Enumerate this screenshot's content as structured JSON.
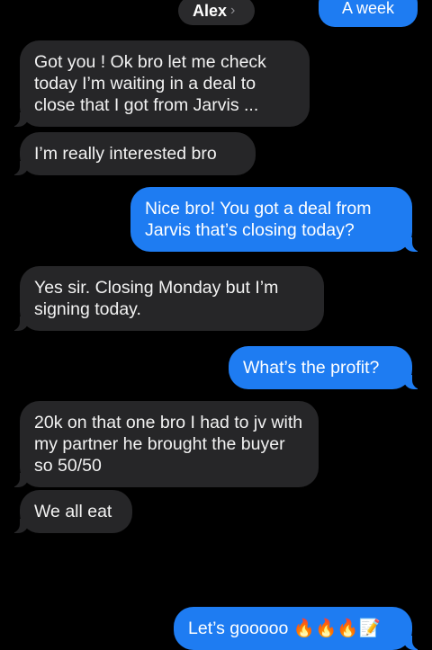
{
  "header": {
    "contact_name": "Alex",
    "chevron": "›",
    "partial_top_message": "A week"
  },
  "messages": [
    {
      "from": "them",
      "text": "Got you ! Ok bro let me check today I’m waiting in a deal to close that I got from Jarvis ..."
    },
    {
      "from": "them",
      "text": "I’m really interested bro"
    },
    {
      "from": "me",
      "text": "Nice bro! You got a deal from Jarvis that’s closing today?"
    },
    {
      "from": "them",
      "text": "Yes sir.  Closing Monday but I’m signing today."
    },
    {
      "from": "me",
      "text": "What’s the profit?"
    },
    {
      "from": "them",
      "text": "20k on that one bro I had to jv with my partner he brought the buyer so 50/50"
    },
    {
      "from": "them",
      "text": "We all eat"
    },
    {
      "from": "me",
      "text": "Let’s gooooo 🔥🔥🔥📝"
    }
  ],
  "colors": {
    "incoming_bubble": "#262628",
    "outgoing_bubble": "#1e7cf2",
    "background": "#000000"
  }
}
